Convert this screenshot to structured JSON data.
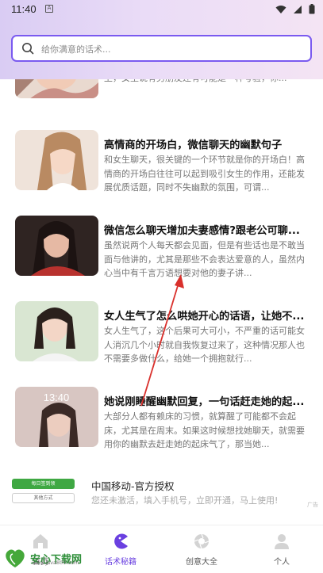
{
  "status_bar": {
    "time": "11:40",
    "notification_letter": "A"
  },
  "search": {
    "placeholder": "给你满意的话术..."
  },
  "articles": [
    {
      "title": "",
      "desc": "以为真，觉得自己没机会了，然后黯然退出。实际上，女生说有男朋友还有可能是一种考验，你..."
    },
    {
      "title": "高情商的开场白，微信聊天的幽默句子",
      "desc": "和女生聊天，很关键的一个环节就是你的开场白！高情商的开场白往往可以起到吸引女生的作用，还能发展优质话题，同时不失幽默的氛围，可谓..."
    },
    {
      "title": "微信怎么聊天增加夫妻感情?跟老公可聊...",
      "desc": "虽然说两个人每天都会见面，但是有些话也是不敢当面与他讲的，尤其是那些不会表达爱意的人，虽然内心当中有千言万语想要对他的妻子讲..."
    },
    {
      "title": "女人生气了怎么哄她开心的话语，让她不...",
      "desc": "女人生气了，这个后果可大可小，不严重的话可能女人消沉几个小时就自我恢复过来了，这种情况那人也不需要多做什么，给她一个拥抱就行..."
    },
    {
      "title": "她说刚睡醒幽默回复，一句话赶走她的起...",
      "desc": "大部分人都有赖床的习惯，就算醒了可能都不会起床，尤其是在周末。如果这时候想找她聊天，就需要用你的幽默去赶走她的起床气了，那当她..."
    }
  ],
  "thumb_overlay_time": "13:40",
  "ad": {
    "button_primary": "每日签到领",
    "button_secondary": "其他方式",
    "title": "中国移动-官方授权",
    "desc": "您还未激活，填入手机号，立即开通，马上使用!",
    "tag": "广告"
  },
  "tabs": [
    {
      "label": "首页",
      "icon": "home-icon",
      "active": false
    },
    {
      "label": "话术秘籍",
      "icon": "pacman-icon",
      "active": true
    },
    {
      "label": "创意大全",
      "icon": "aperture-icon",
      "active": false
    },
    {
      "label": "个人",
      "icon": "person-icon",
      "active": false
    }
  ],
  "watermark": {
    "text": "安心下载网",
    "sub": "www.java800.com"
  },
  "colors": {
    "accent": "#6a40e0",
    "search_border": "#7a5af0"
  }
}
